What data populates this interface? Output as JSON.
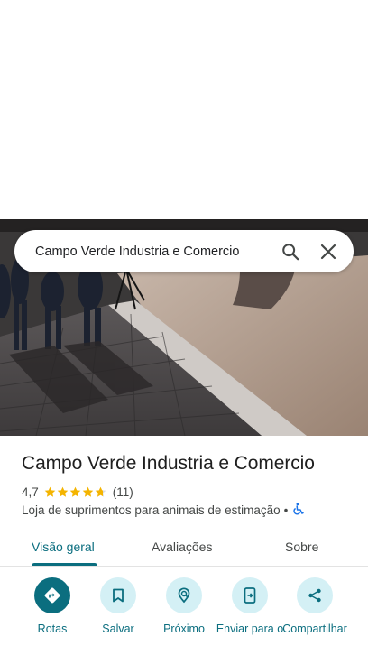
{
  "search": {
    "query": "Campo Verde Industria e Comercio"
  },
  "place": {
    "name": "Campo Verde Industria e Comercio",
    "rating": "4,7",
    "stars": 4.7,
    "review_count": "(11)",
    "category": "Loja de suprimentos para animais de estimação",
    "separator": "•",
    "accessibility_icon": "wheelchair-icon"
  },
  "tabs": [
    {
      "label": "Visão geral",
      "active": true
    },
    {
      "label": "Avaliações",
      "active": false
    },
    {
      "label": "Sobre",
      "active": false
    }
  ],
  "actions": [
    {
      "label": "Rotas",
      "icon": "directions-icon"
    },
    {
      "label": "Salvar",
      "icon": "bookmark-icon"
    },
    {
      "label": "Próximo",
      "icon": "nearby-icon"
    },
    {
      "label": "Enviar para o",
      "icon": "send-to-phone-icon"
    },
    {
      "label": "Compartilhar",
      "icon": "share-icon"
    }
  ],
  "colors": {
    "accent": "#0b6e7f",
    "chip_bg": "#d4f0f5",
    "star": "#f4b400"
  }
}
